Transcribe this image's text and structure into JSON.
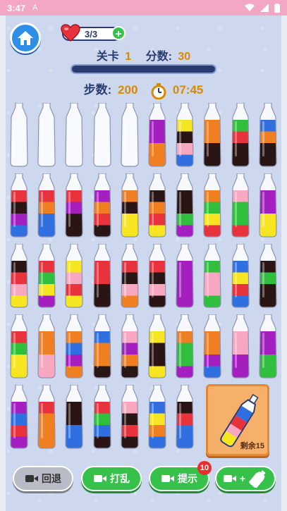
{
  "status": {
    "time": "3:47",
    "notif_icon": "A"
  },
  "header": {
    "lives": "3/3",
    "level_label": "关卡",
    "level_value": "1",
    "score_label": "分数:",
    "score_value": "30",
    "progress": 0.0,
    "steps_label": "步数:",
    "steps_value": "200",
    "timer_value": "07:45"
  },
  "colors": {
    "R": "#e8323c",
    "O": "#f07f22",
    "Y": "#f7e521",
    "G": "#2fbf3c",
    "B": "#2f6fe0",
    "P": "#a51ec0",
    "K": "#2a1515",
    "N": "#f7a7c0",
    "E": "#ffffff"
  },
  "shelves": [
    [
      "EEEE",
      "EEEE",
      "EEEE",
      "EEEE",
      "EEEE",
      "PPOO",
      "YKNB",
      "OOKK",
      "GRKK",
      "BOKK"
    ],
    [
      "RKPB",
      "ROBB",
      "RPKK",
      "PORK",
      "OKYY",
      "KORY",
      "KKGP",
      "OGYR",
      "NGGR",
      "PPYY"
    ],
    [
      "KRNY",
      "RGYP",
      "YNRY",
      "RRKK",
      "RKNO",
      "RKNK",
      "PPPP",
      "GNNG",
      "BYRB",
      "KGKK"
    ],
    [
      "RGYY",
      "OONN",
      "OBPO",
      "BOOK",
      "NPOK",
      "YKKY",
      "OGGP",
      "OOPB",
      "NNPP",
      "PPGG"
    ],
    [
      "PBRP",
      "ROOO",
      "KKBB",
      "RGBK",
      "NKRK",
      "BYOB",
      "KRBB"
    ]
  ],
  "bonus": {
    "remaining": "剩余15"
  },
  "buttons": {
    "undo": "回退",
    "shuffle": "打乱",
    "hint": "提示",
    "hint_badge": "10",
    "add_plus": "+"
  }
}
